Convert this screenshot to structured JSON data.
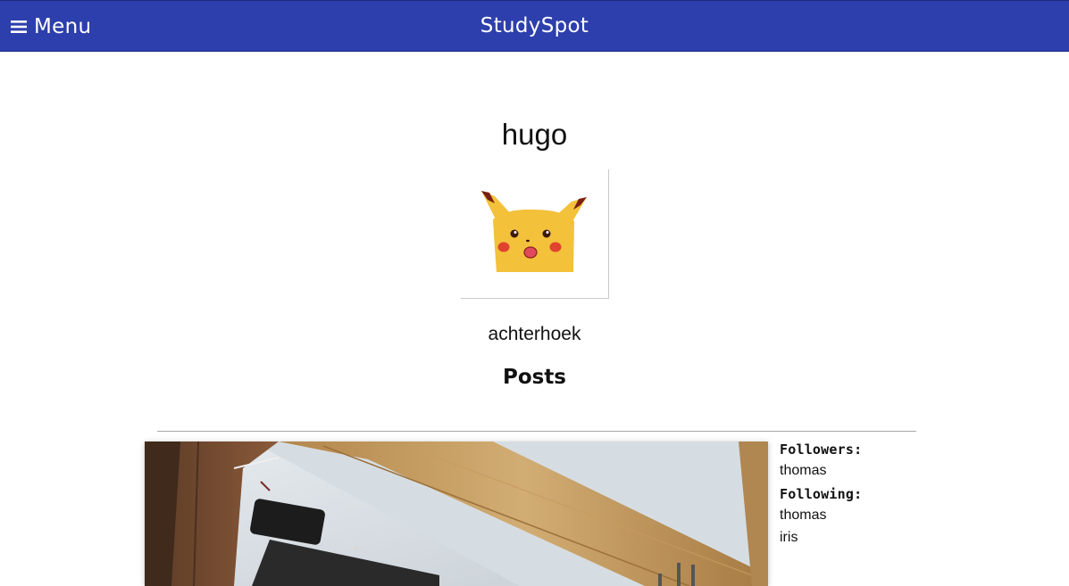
{
  "header": {
    "menu_icon": "hamburger-icon",
    "menu_label": "Menu",
    "brand": "StudySpot",
    "bg_color": "#2d3fac"
  },
  "profile": {
    "username": "hugo",
    "avatar_icon": "surprised-pikachu-avatar",
    "location": "achterhoek",
    "posts_heading": "Posts"
  },
  "post": {
    "image_icon": "post-photo-wooden-beam-ceiling"
  },
  "social": {
    "followers_label": "Followers:",
    "followers": [
      "thomas"
    ],
    "following_label": "Following:",
    "following": [
      "thomas",
      "iris"
    ]
  }
}
